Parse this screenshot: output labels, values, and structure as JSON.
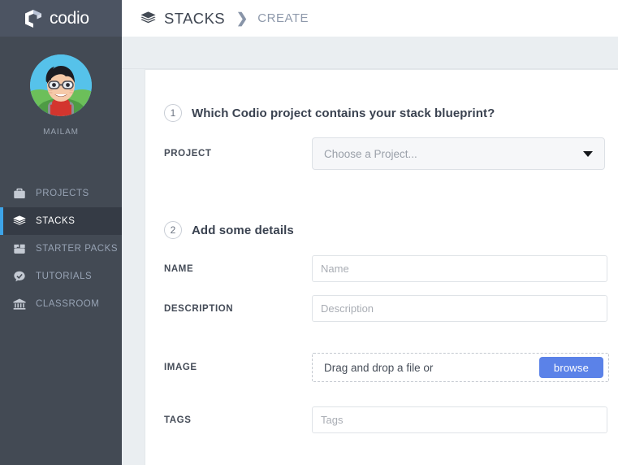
{
  "brand": {
    "name": "codio",
    "logo_icon": "codio-cube-icon",
    "logo_color": "#ffffff",
    "sidebar_color": "#434a54",
    "accent_color": "#3da4e8"
  },
  "profile": {
    "avatar_icon": "user-avatar",
    "username": "MAILAM"
  },
  "sidebar": {
    "items": [
      {
        "label": "PROJECTS",
        "icon": "briefcase-icon",
        "active": false
      },
      {
        "label": "STACKS",
        "icon": "layers-icon",
        "active": true
      },
      {
        "label": "STARTER PACKS",
        "icon": "package-icon",
        "active": false
      },
      {
        "label": "TUTORIALS",
        "icon": "tutorial-icon",
        "active": false
      },
      {
        "label": "CLASSROOM",
        "icon": "classroom-icon",
        "active": false
      }
    ]
  },
  "breadcrumb": {
    "icon": "layers-icon",
    "primary": "STACKS",
    "separator": "❯",
    "secondary": "CREATE"
  },
  "steps": [
    {
      "number": "1",
      "title": "Which Codio project contains your stack blueprint?",
      "fields": [
        {
          "label": "PROJECT",
          "type": "select",
          "value": "",
          "placeholder": "Choose a Project...",
          "caret_icon": "chevron-down-icon"
        }
      ]
    },
    {
      "number": "2",
      "title": "Add some details",
      "fields": [
        {
          "label": "NAME",
          "type": "text",
          "value": "",
          "placeholder": "Name"
        },
        {
          "label": "DESCRIPTION",
          "type": "text",
          "value": "",
          "placeholder": "Description"
        },
        {
          "label": "IMAGE",
          "type": "dropzone",
          "prompt": "Drag and drop a file or",
          "button_label": "browse",
          "button_color": "#5b82e8"
        },
        {
          "label": "TAGS",
          "type": "text",
          "value": "",
          "placeholder": "Tags"
        }
      ]
    }
  ]
}
